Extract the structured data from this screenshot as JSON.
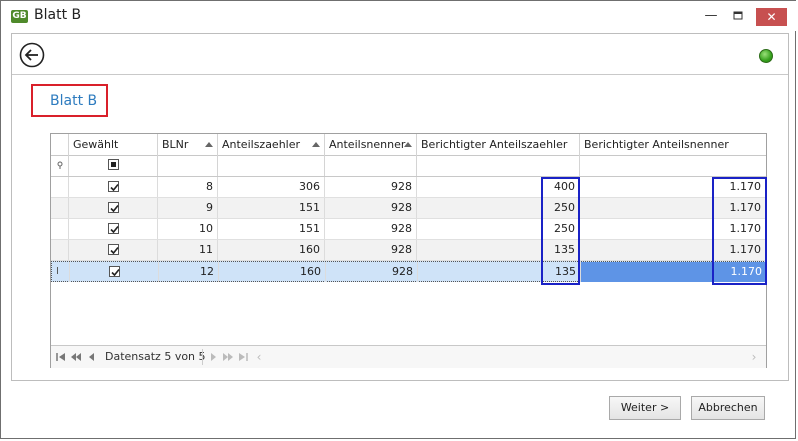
{
  "window": {
    "title": "Blatt B",
    "icon_label": "GB",
    "minimize_glyph": "—",
    "maximize_glyph": "☐",
    "close_glyph": "✕"
  },
  "page": {
    "title": "Blatt B",
    "back_icon": "arrow-left-circle-icon",
    "status": "green"
  },
  "grid": {
    "columns": [
      {
        "label": "Gewählt",
        "sortable": false
      },
      {
        "label": "BLNr",
        "sortable": true
      },
      {
        "label": "Anteilszaehler",
        "sortable": true
      },
      {
        "label": "Anteilsnenner",
        "sortable": true
      },
      {
        "label": "Berichtigter Anteilszaehler",
        "sortable": false
      },
      {
        "label": "Berichtigter Anteilsnenner",
        "sortable": false
      }
    ],
    "filter_pin_icon": "pin-icon",
    "rows": [
      {
        "checked": true,
        "blnr": "8",
        "zaehler": "306",
        "nenner": "928",
        "ber_zaehler": "400",
        "ber_nenner": "1.170"
      },
      {
        "checked": true,
        "blnr": "9",
        "zaehler": "151",
        "nenner": "928",
        "ber_zaehler": "250",
        "ber_nenner": "1.170"
      },
      {
        "checked": true,
        "blnr": "10",
        "zaehler": "151",
        "nenner": "928",
        "ber_zaehler": "250",
        "ber_nenner": "1.170"
      },
      {
        "checked": true,
        "blnr": "11",
        "zaehler": "160",
        "nenner": "928",
        "ber_zaehler": "135",
        "ber_nenner": "1.170"
      },
      {
        "checked": true,
        "blnr": "12",
        "zaehler": "160",
        "nenner": "928",
        "ber_zaehler": "135",
        "ber_nenner": "1.170"
      }
    ],
    "selected_row_index": 4,
    "navigator": {
      "first": "⏮",
      "prev_page": "◀◀",
      "prev": "◀",
      "record_text": "Datensatz 5 von 5",
      "next": "▶",
      "next_page": "▶▶",
      "last": "⏭",
      "scroll_left": "‹",
      "scroll_right": "›"
    }
  },
  "buttons": {
    "next_label": "Weiter >",
    "cancel_label": "Abbrechen"
  }
}
